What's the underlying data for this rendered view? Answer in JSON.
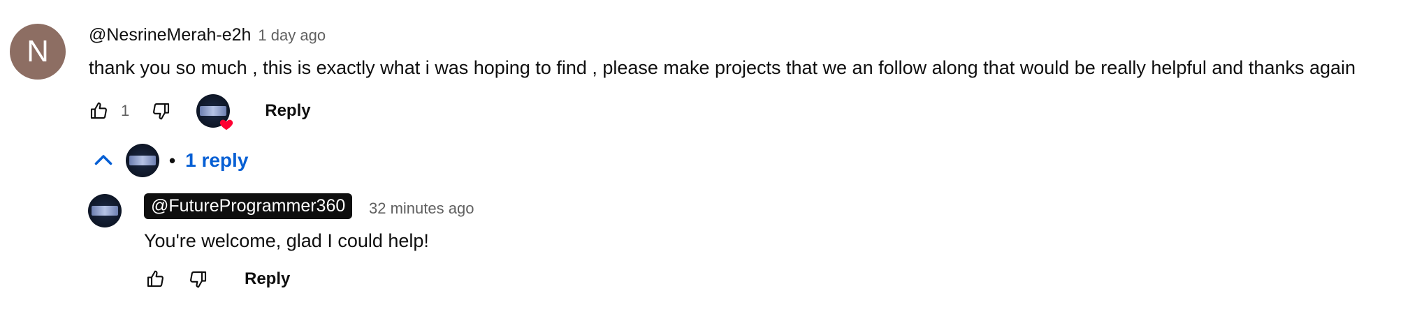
{
  "comment": {
    "avatar_letter": "N",
    "handle": "@NesrineMerah-e2h",
    "time": "1 day ago",
    "text": "thank you so much ,  this is exactly what i was hoping to find , please make projects that we an follow along that would be really helpful and thanks again",
    "like_count": "1",
    "reply_label": "Reply",
    "creator_heart": true
  },
  "replies_toggle": {
    "separator": "•",
    "label": "1 reply"
  },
  "reply": {
    "handle": "@FutureProgrammer360",
    "time": "32 minutes ago",
    "text": "You're welcome, glad I could help!",
    "reply_label": "Reply"
  },
  "colors": {
    "link_blue": "#065fd4",
    "heart_red": "#ff0033",
    "avatar_bg": "#8d6e63",
    "author_badge_bg": "#0f0f0f"
  },
  "icons": {
    "like": "thumb-up-icon",
    "dislike": "thumb-down-icon",
    "collapse": "chevron-up-icon",
    "heart": "heart-icon"
  }
}
